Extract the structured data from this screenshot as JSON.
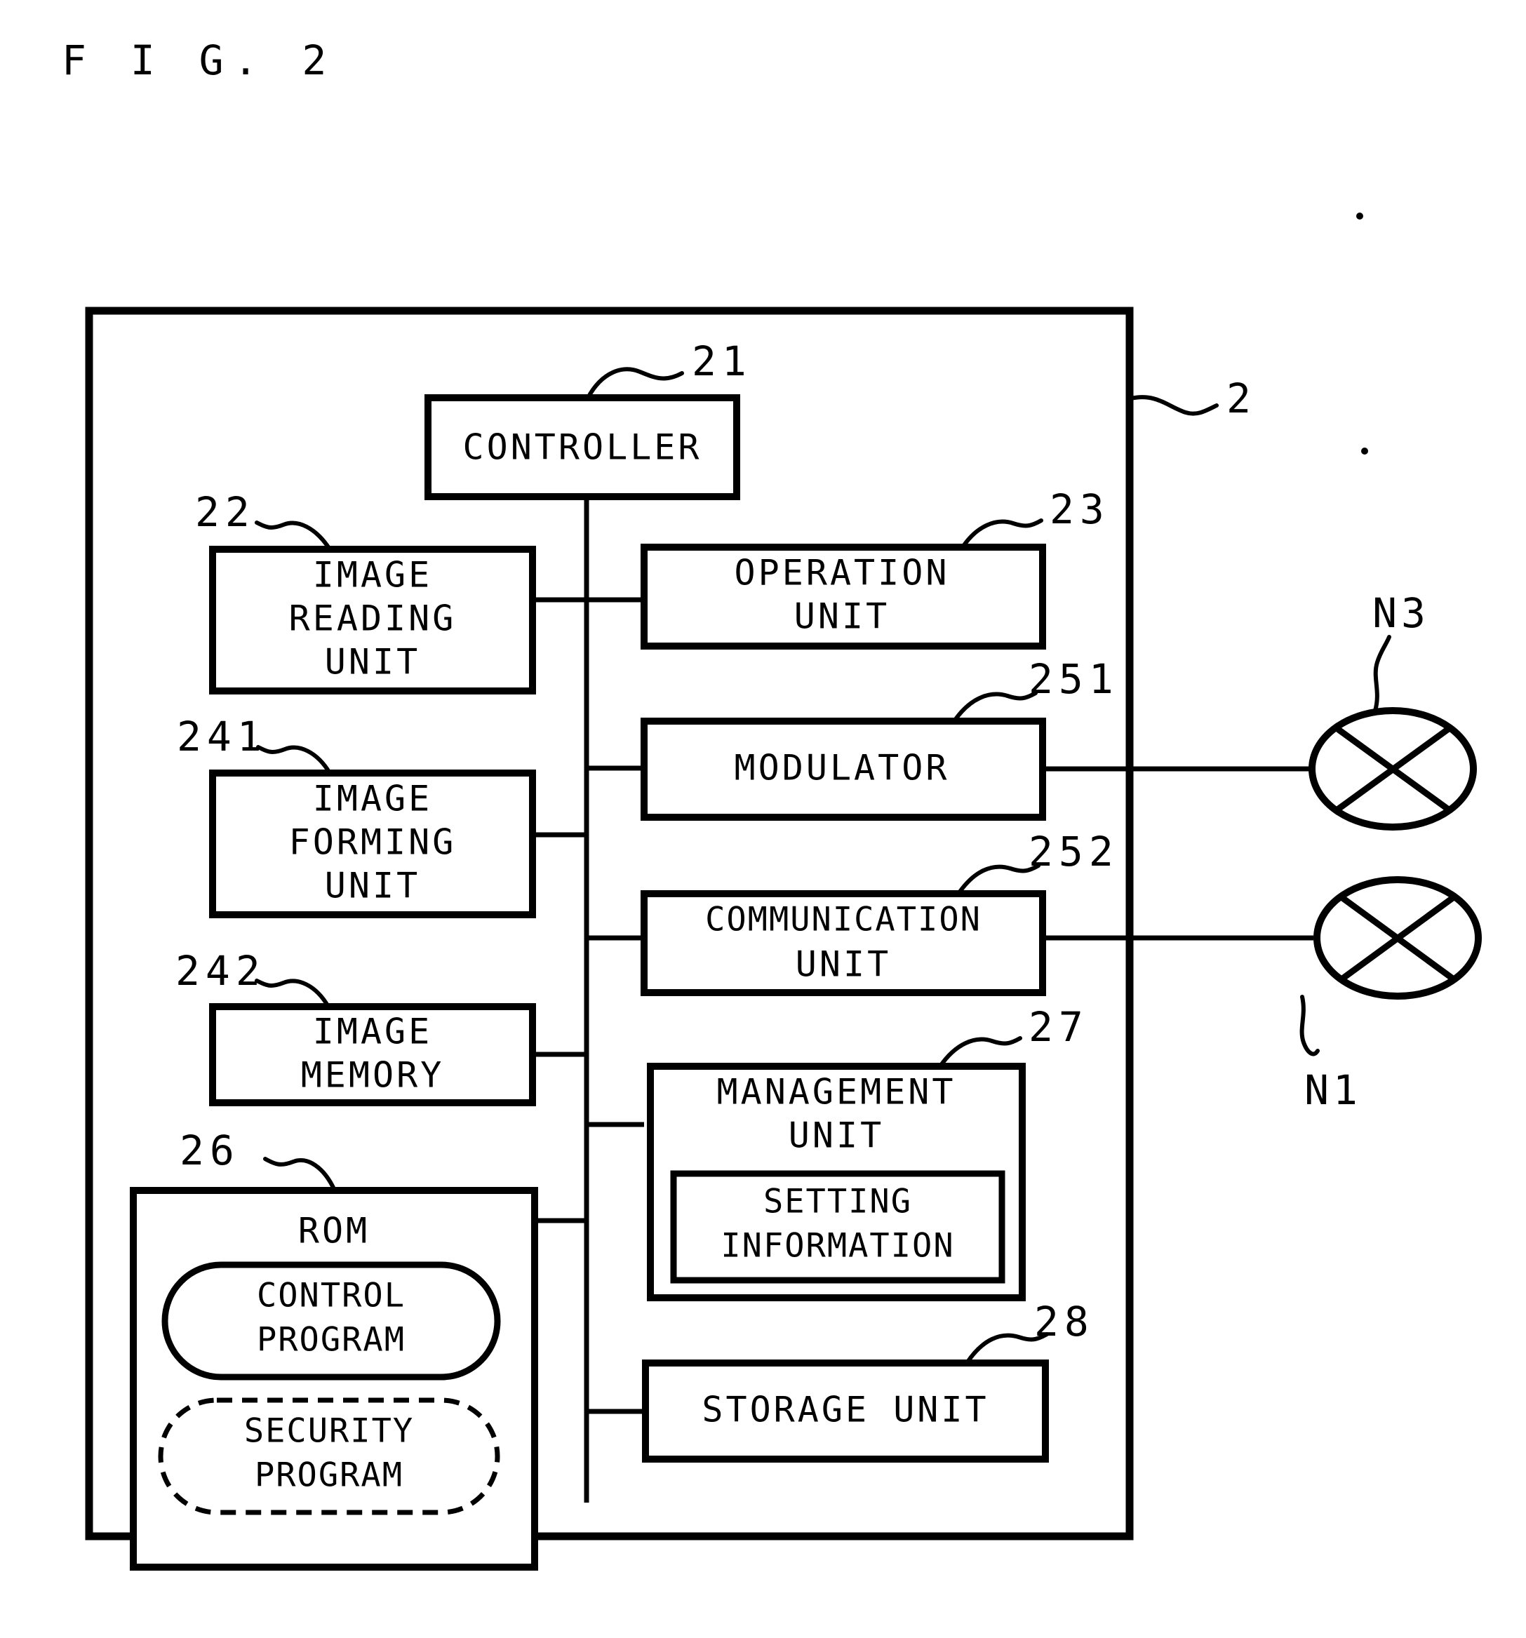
{
  "figure": {
    "title": "F I G. 2",
    "outer_ref": "2"
  },
  "blocks": {
    "controller": {
      "label": "CONTROLLER",
      "ref": "21"
    },
    "image_reading_unit": {
      "line1": "IMAGE",
      "line2": "READING",
      "line3": "UNIT",
      "ref": "22"
    },
    "image_forming_unit": {
      "line1": "IMAGE",
      "line2": "FORMING",
      "line3": "UNIT",
      "ref": "241"
    },
    "image_memory": {
      "line1": "IMAGE",
      "line2": "MEMORY",
      "ref": "242"
    },
    "rom": {
      "label": "ROM",
      "ref": "26",
      "control_program": {
        "line1": "CONTROL",
        "line2": "PROGRAM"
      },
      "security_program": {
        "line1": "SECURITY",
        "line2": "PROGRAM"
      }
    },
    "operation_unit": {
      "line1": "OPERATION",
      "line2": "UNIT",
      "ref": "23"
    },
    "modulator": {
      "label": "MODULATOR",
      "ref": "251"
    },
    "communication_unit": {
      "line1": "COMMUNICATION",
      "line2": "UNIT",
      "ref": "252"
    },
    "management_unit": {
      "line1": "MANAGEMENT",
      "line2": "UNIT",
      "ref": "27",
      "setting_information": {
        "line1": "SETTING",
        "line2": "INFORMATION"
      }
    },
    "storage_unit": {
      "label": "STORAGE UNIT",
      "ref": "28"
    }
  },
  "networks": {
    "n3": {
      "label": "N3"
    },
    "n1": {
      "label": "N1"
    }
  },
  "colors": {
    "stroke": "#000000",
    "background": "#ffffff"
  }
}
